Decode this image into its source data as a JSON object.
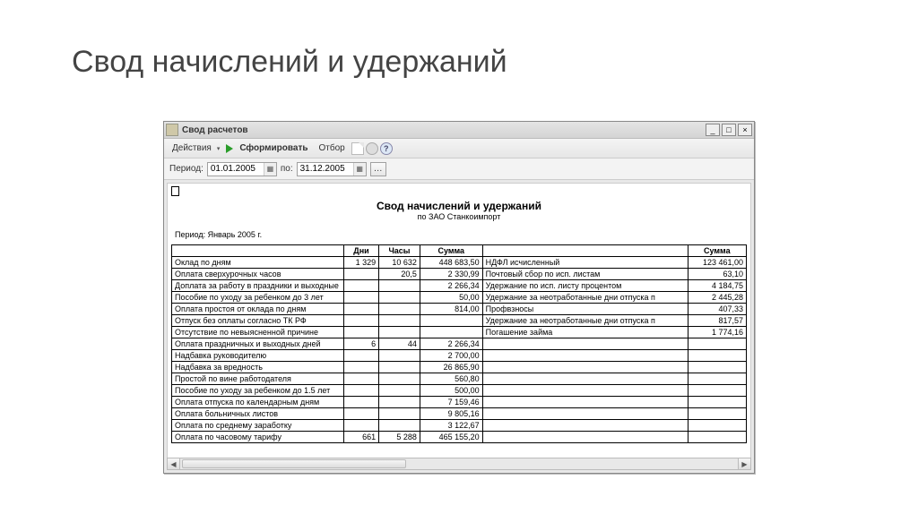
{
  "page": {
    "title": "Свод начислений и удержаний"
  },
  "window": {
    "title": "Свод расчетов"
  },
  "toolbar": {
    "actions": "Действия",
    "form": "Сформировать",
    "filter": "Отбор"
  },
  "period_bar": {
    "label": "Период:",
    "from": "01.01.2005",
    "to_label": "по:",
    "to": "31.12.2005",
    "dots": "…"
  },
  "report": {
    "title": "Свод начислений и удержаний",
    "subtitle": "по   ЗАО Станкоимпорт",
    "period": "Период: Январь 2005 г.",
    "headers": {
      "left_blank": "",
      "days": "Дни",
      "hours": "Часы",
      "sum1": "Сумма",
      "right_blank": "",
      "sum2": "Сумма"
    },
    "rows": [
      {
        "l": "Оклад по дням",
        "d": "1 329",
        "h": "10 632",
        "s": "448 683,50",
        "r": "НДФЛ исчисленный",
        "rs": "123 461,00"
      },
      {
        "l": "Оплата сверхурочных часов",
        "d": "",
        "h": "20,5",
        "s": "2 330,99",
        "r": "Почтовый сбор по исп. листам",
        "rs": "63,10"
      },
      {
        "l": "Доплата за работу в праздники и выходные",
        "d": "",
        "h": "",
        "s": "2 266,34",
        "r": "Удержание по исп. листу процентом",
        "rs": "4 184,75"
      },
      {
        "l": "Пособие по уходу за ребенком до 3 лет",
        "d": "",
        "h": "",
        "s": "50,00",
        "r": "Удержание за неотработанные дни отпуска п",
        "rs": "2 445,28"
      },
      {
        "l": "Оплата простоя от оклада по дням",
        "d": "",
        "h": "",
        "s": "814,00",
        "r": "Профвзносы",
        "rs": "407,33"
      },
      {
        "l": "Отпуск без оплаты согласно ТК РФ",
        "d": "",
        "h": "",
        "s": "",
        "r": "Удержание за неотработанные дни отпуска п",
        "rs": "817,57"
      },
      {
        "l": "Отсутствие по невыясненной причине",
        "d": "",
        "h": "",
        "s": "",
        "r": "Погашение займа",
        "rs": "1 774,16"
      },
      {
        "l": "Оплата праздничных и выходных дней",
        "d": "6",
        "h": "44",
        "s": "2 266,34",
        "r": "",
        "rs": ""
      },
      {
        "l": "Надбавка руководителю",
        "d": "",
        "h": "",
        "s": "2 700,00",
        "r": "",
        "rs": ""
      },
      {
        "l": "Надбавка за вредность",
        "d": "",
        "h": "",
        "s": "26 865,90",
        "r": "",
        "rs": ""
      },
      {
        "l": "Простой по вине работодателя",
        "d": "",
        "h": "",
        "s": "560,80",
        "r": "",
        "rs": ""
      },
      {
        "l": "Пособие по уходу за ребенком до 1.5 лет",
        "d": "",
        "h": "",
        "s": "500,00",
        "r": "",
        "rs": ""
      },
      {
        "l": "Оплата отпуска по календарным дням",
        "d": "",
        "h": "",
        "s": "7 159,46",
        "r": "",
        "rs": ""
      },
      {
        "l": "Оплата больничных листов",
        "d": "",
        "h": "",
        "s": "9 805,16",
        "r": "",
        "rs": ""
      },
      {
        "l": "Оплата по среднему заработку",
        "d": "",
        "h": "",
        "s": "3 122,67",
        "r": "",
        "rs": ""
      },
      {
        "l": "Оплата по часовому тарифу",
        "d": "661",
        "h": "5 288",
        "s": "465 155,20",
        "r": "",
        "rs": ""
      }
    ]
  }
}
